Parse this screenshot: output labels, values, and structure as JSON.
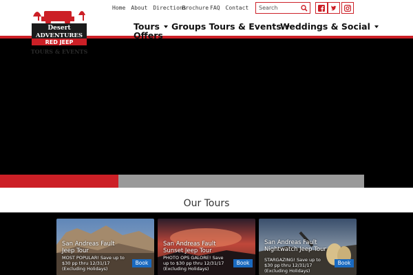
{
  "logo": {
    "line1": "Desert",
    "line2": "ADVENTURES",
    "line3": "RED JEEP",
    "line4": "TOURS & EVENTS"
  },
  "topnav": [
    "Home",
    "About",
    "Directions",
    "Brochure",
    "FAQ",
    "Contact"
  ],
  "search": {
    "placeholder": "Search"
  },
  "social": [
    "facebook-icon",
    "twitter-icon",
    "instagram-icon"
  ],
  "mainnav": [
    {
      "label": "Tours"
    },
    {
      "label": "Groups Tours & Events"
    },
    {
      "label": "Weddings & Social"
    }
  ],
  "offers_label": "Offers",
  "slider": {
    "progress": 0.325
  },
  "tours": {
    "title": "Our Tours",
    "cards": [
      {
        "title": "San Andreas Fault Jeep Tour",
        "desc": "MOST POPULAR! Save up to $30 pp thru 12/31/17 (Excluding Holidays)",
        "book": "Book"
      },
      {
        "title": "San Andreas Fault Sunset Jeep Tour",
        "desc": "PHOTO OPS GALORE! Save up to $30 pp thru 12/31/17 (Excluding Holidays)",
        "book": "Book"
      },
      {
        "title": "San Andreas Fault Nightwatch Jeep Tour",
        "desc": "STARGAZING! Save up to $30 pp thru 12/31/17 (Excluding Holidays)",
        "book": "Book"
      }
    ]
  },
  "colors": {
    "brand_red": "#cc1f26",
    "book_blue": "#1a6ac0"
  }
}
